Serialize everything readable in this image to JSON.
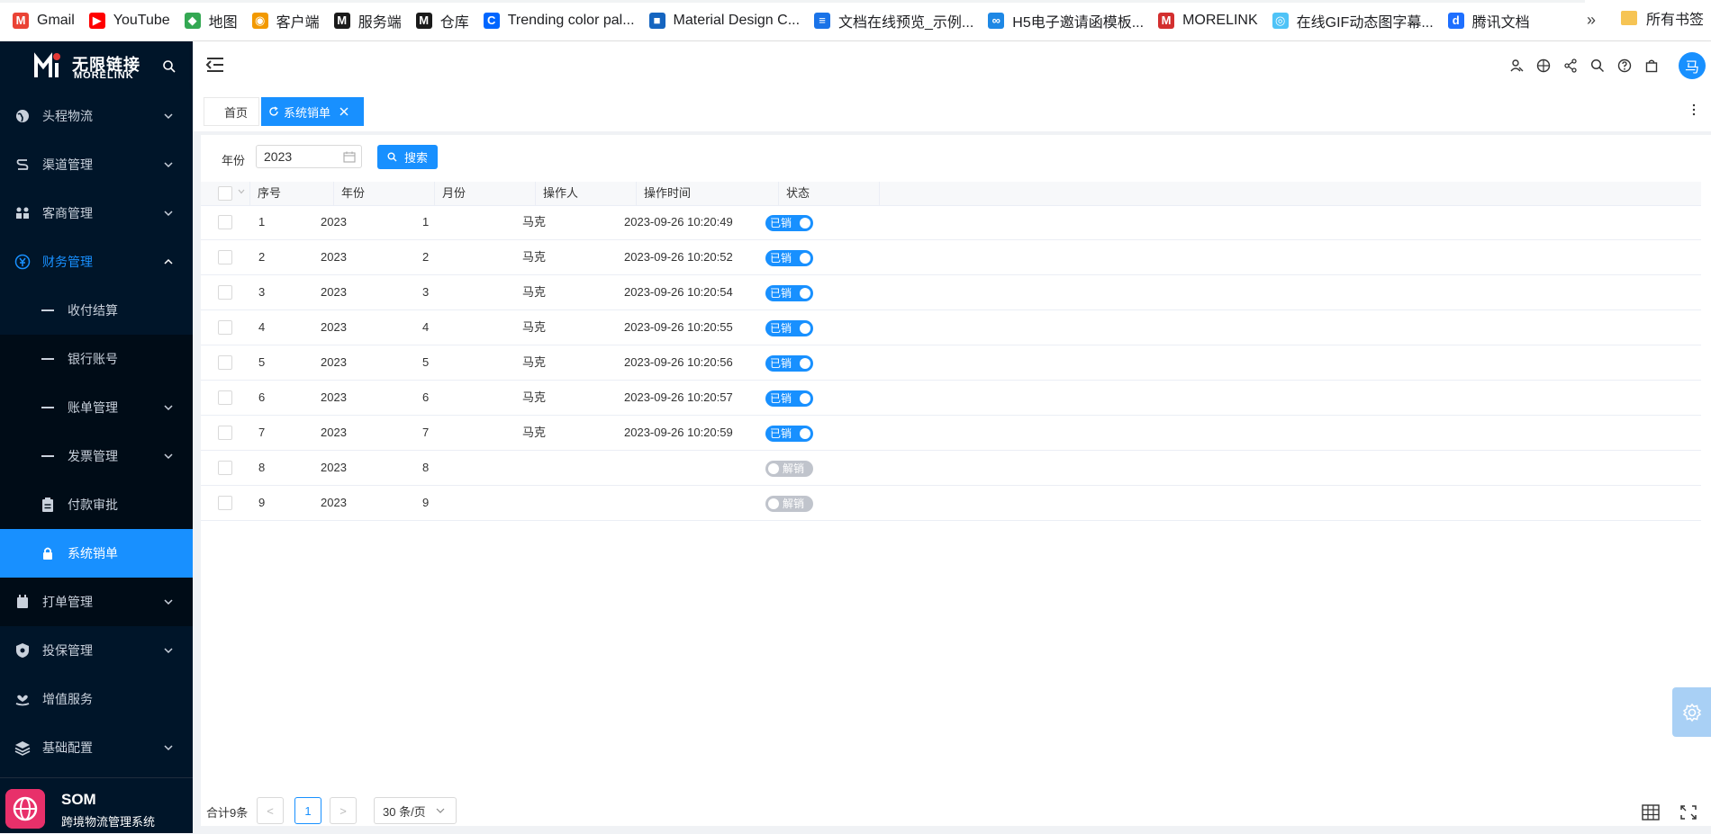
{
  "bookmarks": [
    {
      "label": "Gmail",
      "icon": "gmail-icon",
      "color": "#ea4335"
    },
    {
      "label": "YouTube",
      "icon": "youtube-icon",
      "color": "#ff0000"
    },
    {
      "label": "地图",
      "icon": "map-icon",
      "color": "#34a853"
    },
    {
      "label": "客户端",
      "icon": "client-icon",
      "color": "#f29900"
    },
    {
      "label": "服务端",
      "icon": "server-icon",
      "color": "#1a1a1a"
    },
    {
      "label": "仓库",
      "icon": "warehouse-icon",
      "color": "#1a1a1a"
    },
    {
      "label": "Trending color pal...",
      "icon": "coolors-icon",
      "color": "#0066ff"
    },
    {
      "label": "Material Design C...",
      "icon": "material-icon",
      "color": "#1565c0"
    },
    {
      "label": "文档在线预览_示例...",
      "icon": "doc-icon",
      "color": "#1a73e8"
    },
    {
      "label": "H5电子邀请函模板...",
      "icon": "h5-icon",
      "color": "#1e88e5"
    },
    {
      "label": "MORELINK",
      "icon": "morelink-icon",
      "color": "#d32f2f"
    },
    {
      "label": "在线GIF动态图字幕...",
      "icon": "gif-icon",
      "color": "#4fc3f7"
    },
    {
      "label": "腾讯文档",
      "icon": "tencent-doc-icon",
      "color": "#1e6fff"
    }
  ],
  "bookmarks_folder": "所有书签",
  "bookmarks_more": "»",
  "logo": {
    "cn": "无限链接",
    "en": "MORELINK"
  },
  "menu": [
    {
      "label": "头程物流",
      "icon": "globe-icon",
      "arrow": "down"
    },
    {
      "label": "渠道管理",
      "icon": "route-icon",
      "arrow": "down"
    },
    {
      "label": "客商管理",
      "icon": "users-icon",
      "arrow": "down"
    },
    {
      "label": "财务管理",
      "icon": "yen-icon",
      "arrow": "up"
    },
    {
      "label": "收付结算",
      "sub": true
    },
    {
      "label": "银行账号",
      "sub": true
    },
    {
      "label": "账单管理",
      "sub": true,
      "arrow": "down"
    },
    {
      "label": "发票管理",
      "sub": true,
      "arrow": "down"
    },
    {
      "label": "付款审批",
      "sub": true,
      "icon": "clipboard-icon"
    },
    {
      "label": "系统销单",
      "sub": true,
      "icon": "lock-icon",
      "active": true
    },
    {
      "label": "打单管理",
      "icon": "print-icon",
      "arrow": "down"
    },
    {
      "label": "投保管理",
      "icon": "shield-icon",
      "arrow": "down"
    },
    {
      "label": "增值服务",
      "icon": "heart-hand-icon"
    },
    {
      "label": "基础配置",
      "icon": "layers-icon",
      "arrow": "down"
    }
  ],
  "som": {
    "title": "SOM",
    "subtitle": "跨境物流管理系统"
  },
  "header": {
    "avatar": "马"
  },
  "tabs": {
    "home": "首页",
    "active": "系统销单"
  },
  "search": {
    "year_label": "年份",
    "year_value": "2023",
    "button": "搜索"
  },
  "table": {
    "columns": [
      "序号",
      "年份",
      "月份",
      "操作人",
      "操作时间",
      "状态"
    ],
    "rows": [
      {
        "no": "1",
        "year": "2023",
        "month": "1",
        "operator": "马克",
        "time": "2023-09-26 10:20:49",
        "status": "已销",
        "on": true
      },
      {
        "no": "2",
        "year": "2023",
        "month": "2",
        "operator": "马克",
        "time": "2023-09-26 10:20:52",
        "status": "已销",
        "on": true
      },
      {
        "no": "3",
        "year": "2023",
        "month": "3",
        "operator": "马克",
        "time": "2023-09-26 10:20:54",
        "status": "已销",
        "on": true
      },
      {
        "no": "4",
        "year": "2023",
        "month": "4",
        "operator": "马克",
        "time": "2023-09-26 10:20:55",
        "status": "已销",
        "on": true
      },
      {
        "no": "5",
        "year": "2023",
        "month": "5",
        "operator": "马克",
        "time": "2023-09-26 10:20:56",
        "status": "已销",
        "on": true
      },
      {
        "no": "6",
        "year": "2023",
        "month": "6",
        "operator": "马克",
        "time": "2023-09-26 10:20:57",
        "status": "已销",
        "on": true
      },
      {
        "no": "7",
        "year": "2023",
        "month": "7",
        "operator": "马克",
        "time": "2023-09-26 10:20:59",
        "status": "已销",
        "on": true
      },
      {
        "no": "8",
        "year": "2023",
        "month": "8",
        "operator": "",
        "time": "",
        "status": "解销",
        "on": false
      },
      {
        "no": "9",
        "year": "2023",
        "month": "9",
        "operator": "",
        "time": "",
        "status": "解销",
        "on": false
      }
    ]
  },
  "pagination": {
    "total": "合计9条",
    "current": "1",
    "page_size": "30 条/页",
    "prev": "<",
    "next": ">"
  }
}
